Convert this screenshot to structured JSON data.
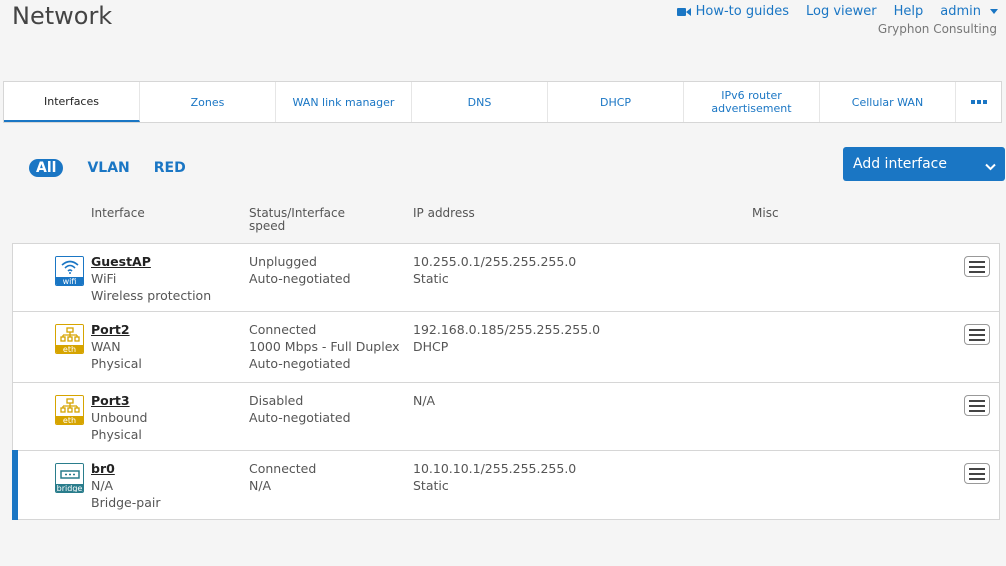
{
  "page": {
    "title": "Network"
  },
  "topnav": {
    "howto_label": "How-to guides",
    "howto_icon": "video-camera-icon",
    "logviewer_label": "Log viewer",
    "help_label": "Help",
    "user_label": "admin",
    "org_name": "Gryphon Consulting"
  },
  "tabs": [
    {
      "label": "Interfaces",
      "active": true
    },
    {
      "label": "Zones"
    },
    {
      "label": "WAN link manager"
    },
    {
      "label": "DNS"
    },
    {
      "label": "DHCP"
    },
    {
      "label": "IPv6 router advertisement"
    },
    {
      "label": "Cellular WAN"
    }
  ],
  "filters": [
    {
      "label": "All",
      "active": true
    },
    {
      "label": "VLAN"
    },
    {
      "label": "RED"
    }
  ],
  "add_button": {
    "label": "Add interface"
  },
  "columns": {
    "interface": "Interface",
    "status": "Status/Interface speed",
    "ip": "IP address",
    "misc": "Misc"
  },
  "accent_color": "#1a76c4",
  "rows": [
    {
      "icon": "wifi-icon",
      "icon_label": "wifi",
      "name": "GuestAP",
      "type": "WiFi",
      "subtype": "Wireless protection",
      "status": "Unplugged",
      "speed": "",
      "negotiation": "Auto-negotiated",
      "ip": "10.255.0.1/255.255.255.0",
      "mode": "Static"
    },
    {
      "icon": "ethernet-icon",
      "icon_label": "eth",
      "name": "Port2",
      "type": "WAN",
      "subtype": "Physical",
      "status": "Connected",
      "speed": "1000 Mbps - Full Duplex",
      "negotiation": "Auto-negotiated",
      "ip": "192.168.0.185/255.255.255.0",
      "mode": "DHCP"
    },
    {
      "icon": "ethernet-icon",
      "icon_label": "eth",
      "name": "Port3",
      "type": "Unbound",
      "subtype": "Physical",
      "status": "Disabled",
      "speed": "",
      "negotiation": "Auto-negotiated",
      "ip": "N/A",
      "mode": ""
    },
    {
      "icon": "bridge-icon",
      "icon_label": "bridge",
      "name": "br0",
      "type": "N/A",
      "subtype": "Bridge-pair",
      "status": "Connected",
      "speed": "",
      "negotiation": "N/A",
      "ip": "10.10.10.1/255.255.255.0",
      "mode": "Static",
      "selected": true
    }
  ]
}
